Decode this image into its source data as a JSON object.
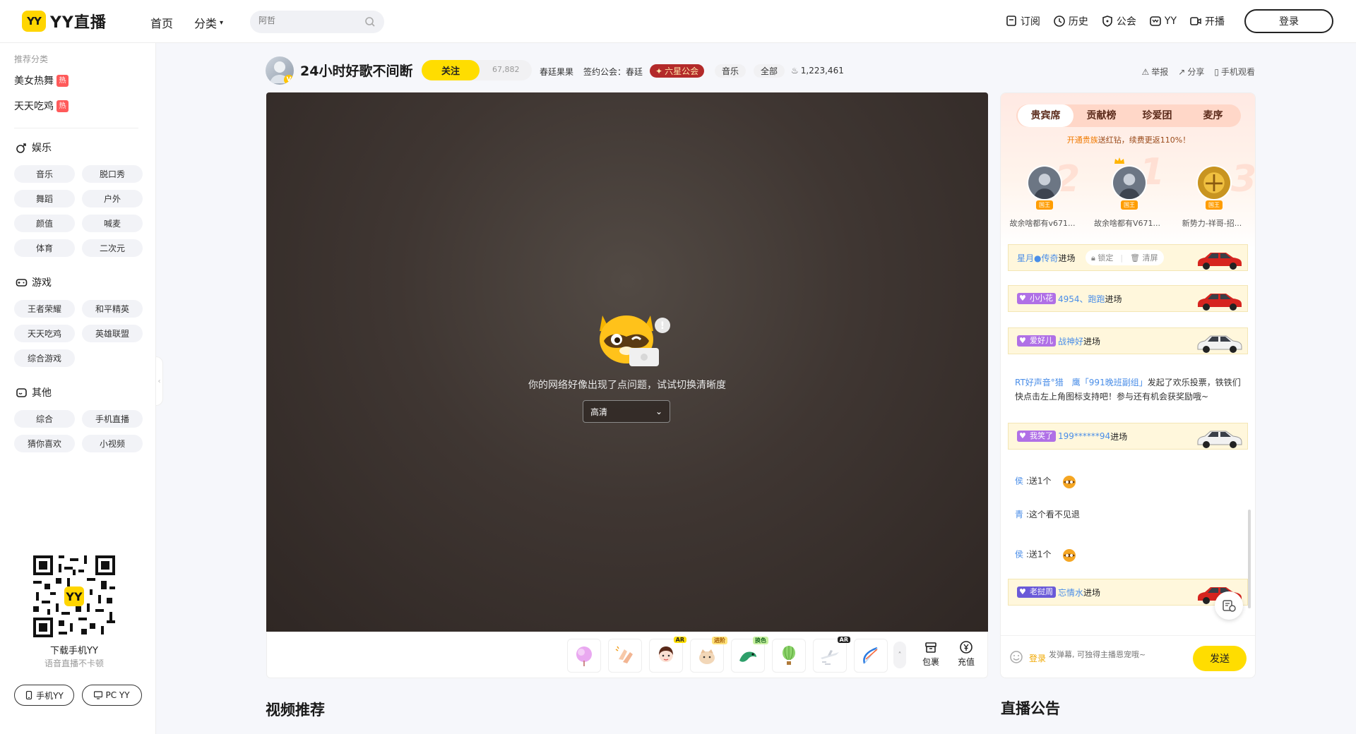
{
  "header": {
    "logo_badge": "YY",
    "logo_text": "YY直播",
    "nav_home": "首页",
    "nav_category": "分类",
    "search_placeholder": "阿哲",
    "links": [
      "订阅",
      "历史",
      "公会",
      "YY",
      "开播"
    ],
    "login": "登录"
  },
  "sidebar": {
    "rec_title": "推荐分类",
    "rec_items": [
      "美女热舞",
      "天天吃鸡"
    ],
    "hot_label": "热",
    "sections": [
      {
        "title": "娱乐",
        "items": [
          "音乐",
          "脱口秀",
          "舞蹈",
          "户外",
          "颜值",
          "喊麦",
          "体育",
          "二次元"
        ]
      },
      {
        "title": "游戏",
        "items": [
          "王者荣耀",
          "和平精英",
          "天天吃鸡",
          "英雄联盟",
          "综合游戏"
        ]
      },
      {
        "title": "其他",
        "items": [
          "综合",
          "手机直播",
          "猜你喜欢",
          "小视频"
        ]
      }
    ],
    "qr_title": "下载手机YY",
    "qr_sub": "语音直播不卡顿",
    "btn_mobile": "手机YY",
    "btn_pc": "PC YY"
  },
  "room": {
    "title": "24小时好歌不间断",
    "follow": "关注",
    "followers": "67,882",
    "host": "春廷果果",
    "guild": "签约公会：春廷",
    "star_guild": "六星公会",
    "tag_music": "音乐",
    "tag_all": "全部",
    "heat": "1,223,461",
    "actions": [
      "举报",
      "分享",
      "手机观看"
    ]
  },
  "player": {
    "error_text": "你的网络好像出现了点问题，试试切换清晰度",
    "quality": "高清",
    "gift_tags": [
      "AR",
      "进阶",
      "换色",
      "AR"
    ],
    "bag": "包裹",
    "recharge": "充值"
  },
  "rank": {
    "tabs": [
      "贵宾席",
      "贡献榜",
      "珍爱团",
      "麦序"
    ],
    "noble_tip_hl": "开通贵族",
    "noble_tip": "送红钻，续费更返110%！",
    "podium": [
      {
        "name": "故余啥都有v671...",
        "badge": "国王",
        "num": "2"
      },
      {
        "name": "故余啥都有V671...",
        "badge": "国王",
        "num": "1"
      },
      {
        "name": "新势力-祥哥-招...",
        "badge": "国王",
        "num": "3"
      }
    ]
  },
  "chat": {
    "lock": "锁定",
    "clear": "清屏",
    "enter_suffix": "进场",
    "entries": [
      {
        "lvl": "",
        "name": "星月●传奇"
      },
      {
        "lvl": "小小花",
        "name": "4954、跑跑"
      },
      {
        "lvl": "爱好儿",
        "name": "战神好"
      },
      {
        "lvl": "我笑了",
        "name": "199******94"
      },
      {
        "lvl": "老挝周",
        "name": "忘情水"
      }
    ],
    "vote_nick": "RT好声音°猎　鹰「991晚班副组」",
    "vote_text": "发起了欢乐投票，铁铁们快点击左上角图标支持吧！参与还有机会获奖励哦~",
    "gift1_nick": "侯",
    "gift_text": "送1个",
    "msg_nick": "青",
    "msg_text": "这个看不见退",
    "gift2_nick": "侯",
    "input_login": "登录",
    "input_placeholder": "发弹幕, 可独得主播恩宠哦~",
    "send": "发送"
  },
  "sections": {
    "video_rec": "视频推荐",
    "notice": "直播公告"
  }
}
